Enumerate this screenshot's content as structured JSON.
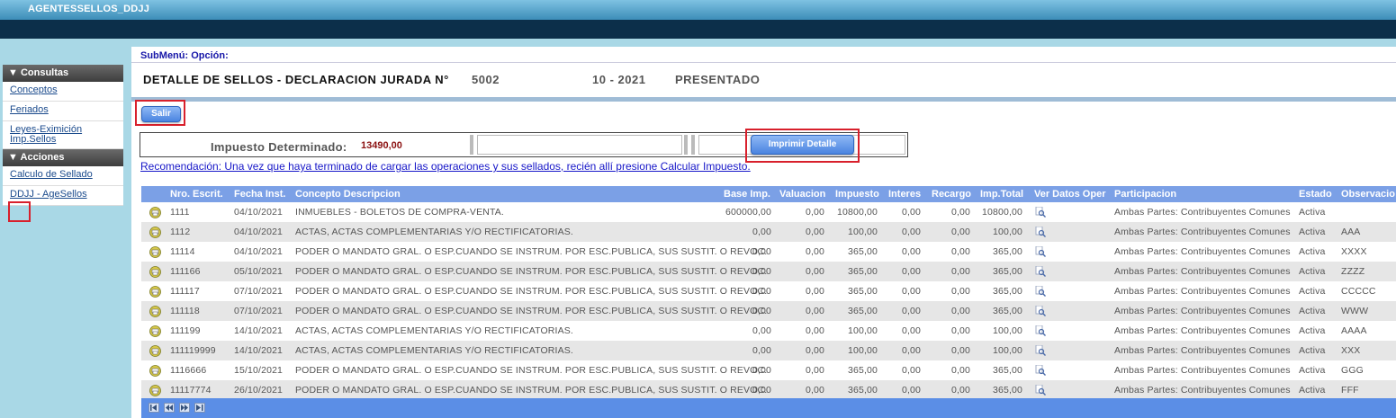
{
  "app": {
    "title": "AGENTESSELLOS_DDJJ"
  },
  "sidebar": {
    "sections": [
      {
        "header": "▼ Consultas",
        "items": [
          "Conceptos",
          "Feriados",
          "Leyes-Eximición Imp.Sellos"
        ]
      },
      {
        "header": "▼ Acciones",
        "items": [
          "Calculo de Sellado",
          "DDJJ - AgeSellos"
        ]
      }
    ]
  },
  "main": {
    "submenu": "SubMenú: Opción:",
    "title": "DETALLE DE SELLOS - DECLARACION JURADA N°",
    "decl_number": "5002",
    "period": "10 - 2021",
    "status": "PRESENTADO",
    "salir_label": "Salir",
    "impuesto_label": "Impuesto Determinado:",
    "impuesto_value": "13490,00",
    "print_label": "Imprimir Detalle",
    "recommendation": "Recomendación: Una vez que haya terminado de cargar las operaciones y sus sellados, recién allí presione Calcular Impuesto."
  },
  "table": {
    "headers": [
      "Nro. Escrit.",
      "Fecha Inst.",
      "Concepto Descripcion",
      "Base Imp.",
      "Valuacion",
      "Impuesto",
      "Interes",
      "Recargo",
      "Imp.Total",
      "Ver Datos Oper",
      "Participacion",
      "Estado",
      "Observacio"
    ],
    "rows": [
      {
        "nro": "1111",
        "fecha": "04/10/2021",
        "concepto": "INMUEBLES - BOLETOS DE COMPRA-VENTA.",
        "base": "600000,00",
        "valuacion": "0,00",
        "impuesto": "10800,00",
        "interes": "0,00",
        "recargo": "0,00",
        "total": "10800,00",
        "participacion": "Ambas Partes: Contribuyentes Comunes",
        "estado": "Activa",
        "obs": ""
      },
      {
        "nro": "1112",
        "fecha": "04/10/2021",
        "concepto": "ACTAS, ACTAS COMPLEMENTARIAS Y/O RECTIFICATORIAS.",
        "base": "0,00",
        "valuacion": "0,00",
        "impuesto": "100,00",
        "interes": "0,00",
        "recargo": "0,00",
        "total": "100,00",
        "participacion": "Ambas Partes: Contribuyentes Comunes",
        "estado": "Activa",
        "obs": "AAA"
      },
      {
        "nro": "11114",
        "fecha": "04/10/2021",
        "concepto": "PODER O MANDATO GRAL. O ESP.CUANDO SE INSTRUM. POR ESC.PUBLICA, SUS SUSTIT. O REVOC.",
        "base": "0,00",
        "valuacion": "0,00",
        "impuesto": "365,00",
        "interes": "0,00",
        "recargo": "0,00",
        "total": "365,00",
        "participacion": "Ambas Partes: Contribuyentes Comunes",
        "estado": "Activa",
        "obs": "XXXX"
      },
      {
        "nro": "111166",
        "fecha": "05/10/2021",
        "concepto": "PODER O MANDATO GRAL. O ESP.CUANDO SE INSTRUM. POR ESC.PUBLICA, SUS SUSTIT. O REVOC.",
        "base": "0,00",
        "valuacion": "0,00",
        "impuesto": "365,00",
        "interes": "0,00",
        "recargo": "0,00",
        "total": "365,00",
        "participacion": "Ambas Partes: Contribuyentes Comunes",
        "estado": "Activa",
        "obs": "ZZZZ"
      },
      {
        "nro": "111117",
        "fecha": "07/10/2021",
        "concepto": "PODER O MANDATO GRAL. O ESP.CUANDO SE INSTRUM. POR ESC.PUBLICA, SUS SUSTIT. O REVOC.",
        "base": "0,00",
        "valuacion": "0,00",
        "impuesto": "365,00",
        "interes": "0,00",
        "recargo": "0,00",
        "total": "365,00",
        "participacion": "Ambas Partes: Contribuyentes Comunes",
        "estado": "Activa",
        "obs": "CCCCC"
      },
      {
        "nro": "111118",
        "fecha": "07/10/2021",
        "concepto": "PODER O MANDATO GRAL. O ESP.CUANDO SE INSTRUM. POR ESC.PUBLICA, SUS SUSTIT. O REVOC.",
        "base": "0,00",
        "valuacion": "0,00",
        "impuesto": "365,00",
        "interes": "0,00",
        "recargo": "0,00",
        "total": "365,00",
        "participacion": "Ambas Partes: Contribuyentes Comunes",
        "estado": "Activa",
        "obs": "WWW"
      },
      {
        "nro": "111199",
        "fecha": "14/10/2021",
        "concepto": "ACTAS, ACTAS COMPLEMENTARIAS Y/O RECTIFICATORIAS.",
        "base": "0,00",
        "valuacion": "0,00",
        "impuesto": "100,00",
        "interes": "0,00",
        "recargo": "0,00",
        "total": "100,00",
        "participacion": "Ambas Partes: Contribuyentes Comunes",
        "estado": "Activa",
        "obs": "AAAA"
      },
      {
        "nro": "111119999",
        "fecha": "14/10/2021",
        "concepto": "ACTAS, ACTAS COMPLEMENTARIAS Y/O RECTIFICATORIAS.",
        "base": "0,00",
        "valuacion": "0,00",
        "impuesto": "100,00",
        "interes": "0,00",
        "recargo": "0,00",
        "total": "100,00",
        "participacion": "Ambas Partes: Contribuyentes Comunes",
        "estado": "Activa",
        "obs": "XXX"
      },
      {
        "nro": "1116666",
        "fecha": "15/10/2021",
        "concepto": "PODER O MANDATO GRAL. O ESP.CUANDO SE INSTRUM. POR ESC.PUBLICA, SUS SUSTIT. O REVOC.",
        "base": "0,00",
        "valuacion": "0,00",
        "impuesto": "365,00",
        "interes": "0,00",
        "recargo": "0,00",
        "total": "365,00",
        "participacion": "Ambas Partes: Contribuyentes Comunes",
        "estado": "Activa",
        "obs": "GGG"
      },
      {
        "nro": "11117774",
        "fecha": "26/10/2021",
        "concepto": "PODER O MANDATO GRAL. O ESP.CUANDO SE INSTRUM. POR ESC.PUBLICA, SUS SUSTIT. O REVOC.",
        "base": "0,00",
        "valuacion": "0,00",
        "impuesto": "365,00",
        "interes": "0,00",
        "recargo": "0,00",
        "total": "365,00",
        "participacion": "Ambas Partes: Contribuyentes Comunes",
        "estado": "Activa",
        "obs": "FFF"
      }
    ]
  },
  "pager": {
    "buttons": [
      "first-page-icon",
      "prev-page-icon",
      "next-page-icon",
      "last-page-icon"
    ]
  },
  "colors": {
    "header_bar": "#7ba0e6",
    "navbar": "#0c2f4a",
    "sidebar_bg": "#a9d8e6",
    "highlight": "#d8202c",
    "value_red": "#8b1010"
  }
}
